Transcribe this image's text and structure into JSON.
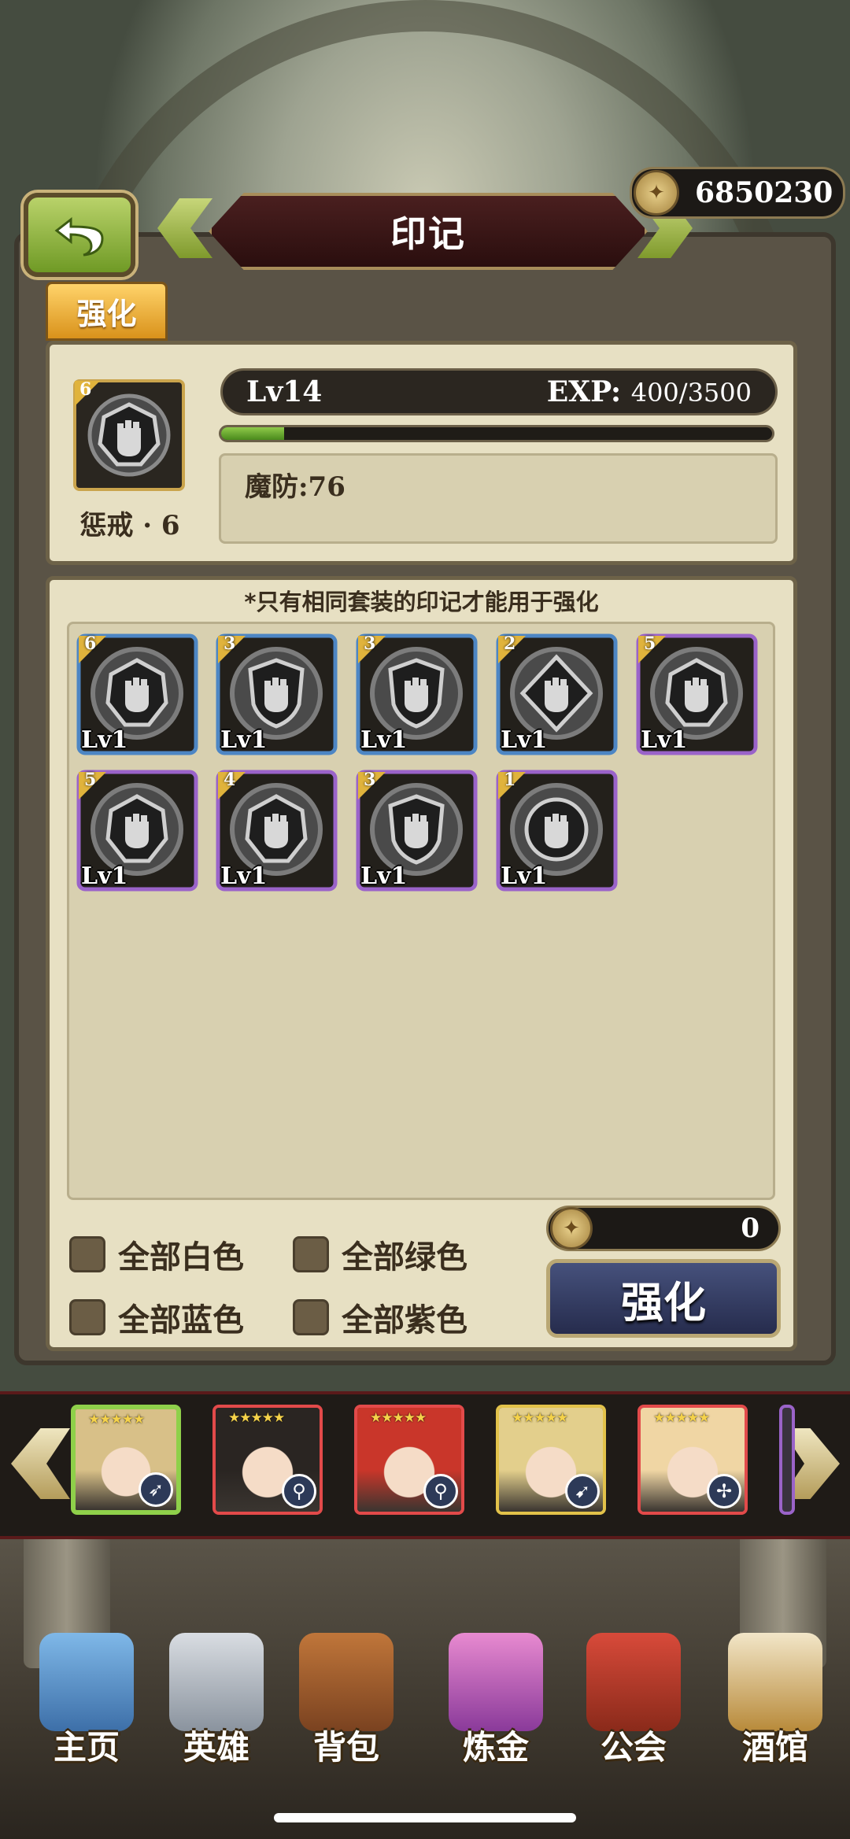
{
  "header": {
    "title": "印记",
    "gold": "6850230"
  },
  "tabs": [
    {
      "label": "强化"
    }
  ],
  "selected": {
    "count": "6",
    "name": "惩戒 · 6",
    "level": "Lv14",
    "exp_label": "EXP:",
    "exp_value": "400/3500",
    "exp_progress": 0.114,
    "stat": "魔防:76"
  },
  "notice": "*只有相同套装的印记才能用于强化",
  "items": [
    {
      "count": "6",
      "level": "Lv1",
      "frame": "blue",
      "shape": "hexagon"
    },
    {
      "count": "3",
      "level": "Lv1",
      "frame": "blue",
      "shape": "shield"
    },
    {
      "count": "3",
      "level": "Lv1",
      "frame": "blue",
      "shape": "shield"
    },
    {
      "count": "2",
      "level": "Lv1",
      "frame": "blue",
      "shape": "diamond"
    },
    {
      "count": "5",
      "level": "Lv1",
      "frame": "purple",
      "shape": "hexagon"
    },
    {
      "count": "5",
      "level": "Lv1",
      "frame": "purple",
      "shape": "hexagon"
    },
    {
      "count": "4",
      "level": "Lv1",
      "frame": "purple",
      "shape": "hexagon"
    },
    {
      "count": "3",
      "level": "Lv1",
      "frame": "purple",
      "shape": "shield"
    },
    {
      "count": "1",
      "level": "Lv1",
      "frame": "purple",
      "shape": "circle"
    }
  ],
  "filters": [
    {
      "label": "全部白色"
    },
    {
      "label": "全部绿色"
    },
    {
      "label": "全部蓝色"
    },
    {
      "label": "全部紫色"
    }
  ],
  "cost": "0",
  "enhance_button": "强化",
  "heroes": [
    {
      "name": "hero-1",
      "class_icon": "arrow-icon",
      "selected": true
    },
    {
      "name": "hero-2",
      "class_icon": "staff-icon",
      "selected": false
    },
    {
      "name": "hero-3",
      "class_icon": "staff-icon",
      "selected": false
    },
    {
      "name": "hero-4",
      "class_icon": "bow-icon",
      "selected": false
    },
    {
      "name": "hero-5",
      "class_icon": "crossbow-icon",
      "selected": false
    }
  ],
  "nav": [
    {
      "label": "主页",
      "icon": "castle-icon"
    },
    {
      "label": "英雄",
      "icon": "helmet-icon"
    },
    {
      "label": "背包",
      "icon": "bag-icon"
    },
    {
      "label": "炼金",
      "icon": "flask-icon"
    },
    {
      "label": "公会",
      "icon": "shield-icon"
    },
    {
      "label": "酒馆",
      "icon": "beer-icon"
    }
  ],
  "colors": {
    "frame_blue": "#4d86c4",
    "frame_purple": "#9a63c9",
    "accent_green": "#6f9a25",
    "gold_tab": "#e3a32a"
  }
}
